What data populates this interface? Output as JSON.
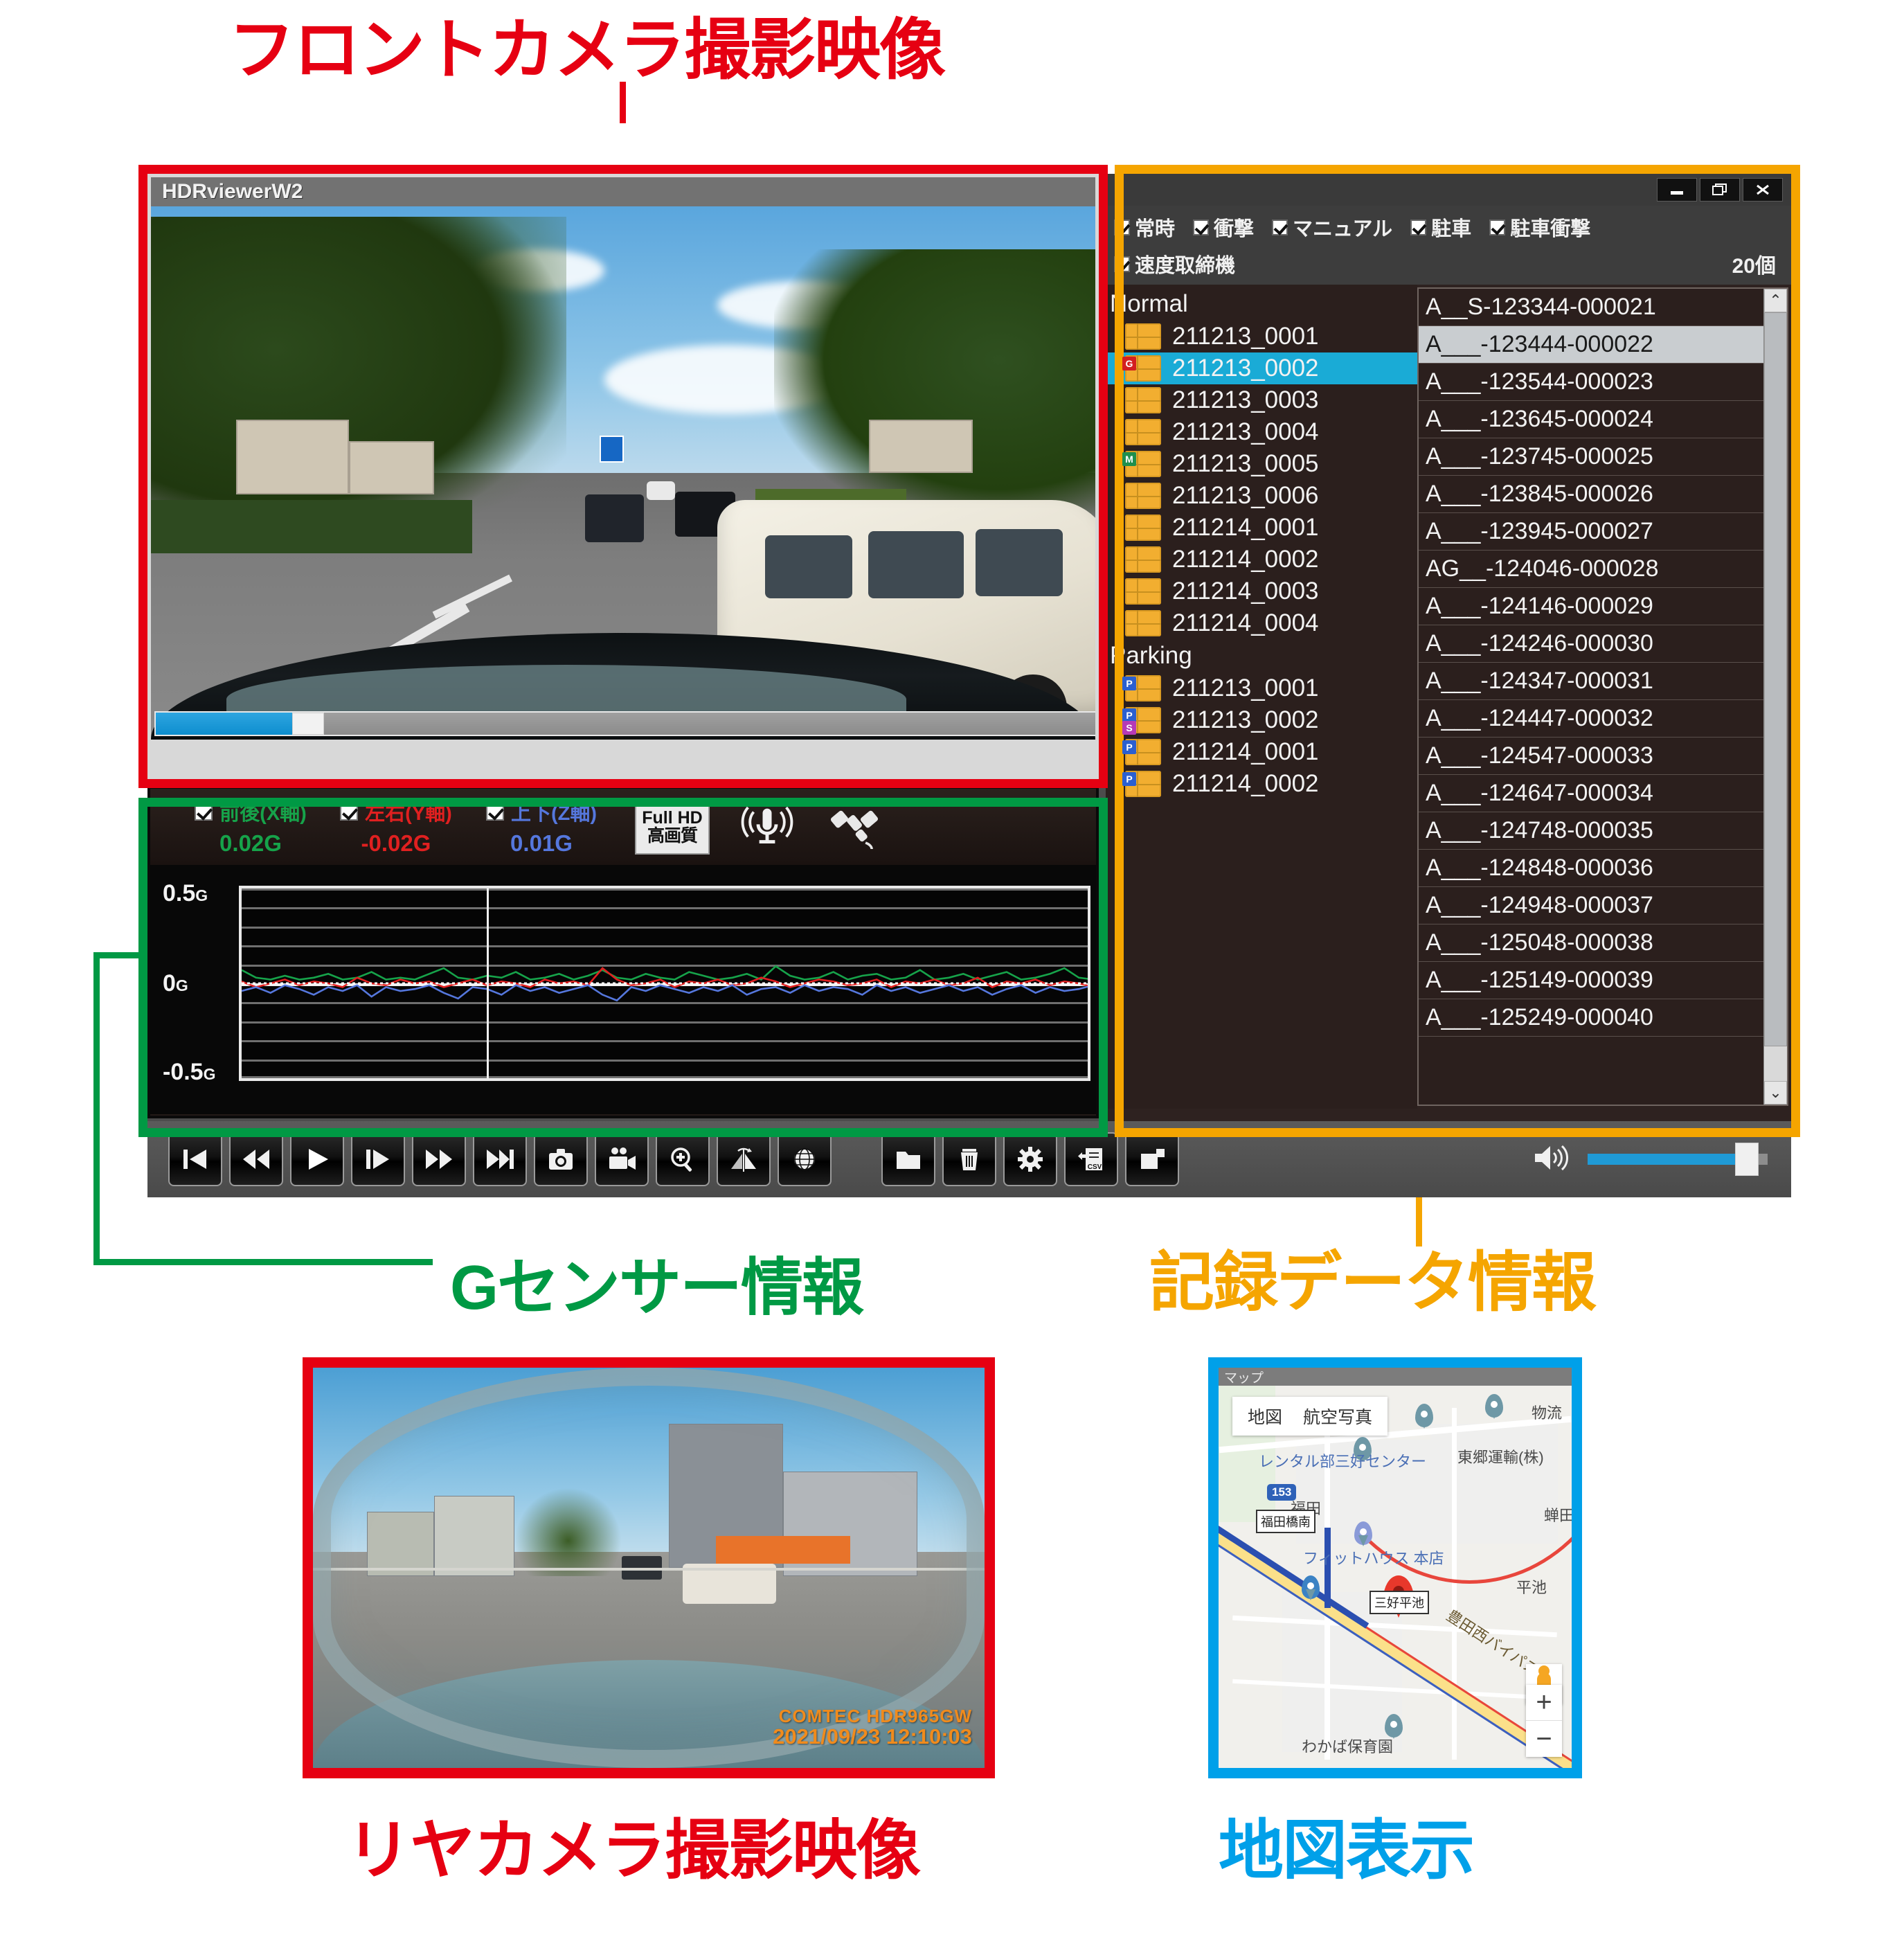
{
  "annotations": {
    "front_camera": "フロントカメラ撮影映像",
    "g_sensor": "Gセンサー情報",
    "record_data": "記録データ情報",
    "rear_camera": "リヤカメラ撮影映像",
    "map_display": "地図表示"
  },
  "colors": {
    "red": "#e60012",
    "green": "#009944",
    "orange": "#f5a500",
    "blue": "#00a0e9",
    "selection_cyan": "#1aabd6"
  },
  "front_panel": {
    "title": "HDRviewerW2",
    "seek_percent": 14.5
  },
  "g_sensor": {
    "axes": [
      {
        "label": "前後(X軸)",
        "value": "0.02G",
        "checked": true,
        "color": "#16a34a"
      },
      {
        "label": "左右(Y軸)",
        "value": "-0.02G",
        "checked": true,
        "color": "#e02020"
      },
      {
        "label": "上下(Z軸)",
        "value": "0.01G",
        "checked": true,
        "color": "#5577dd"
      }
    ],
    "quality_badge": {
      "line1": "Full HD",
      "line2": "高画質"
    },
    "mic_icon": "microphone-icon",
    "gps_icon": "satellite-icon",
    "y_labels": {
      "top": "0.5",
      "mid": "0",
      "bottom": "-0.5"
    },
    "y_unit": "G"
  },
  "chart_data": {
    "type": "line",
    "title": "Gセンサー情報",
    "xlabel": "",
    "ylabel": "G",
    "ylim": [
      -0.5,
      0.5
    ],
    "grid": true,
    "cursor_position_pct": 29,
    "series": [
      {
        "name": "前後(X軸)",
        "color": "#16a34a",
        "current": 0.02,
        "values": [
          0.07,
          0.03,
          0.02,
          0.04,
          0.02,
          0.03,
          0.05,
          0.02,
          0.03,
          0.06,
          0.02,
          0.03,
          0.02,
          0.05,
          0.08,
          0.03,
          0.02,
          0.04,
          0.03,
          0.06,
          0.02,
          0.03,
          0.05,
          0.02,
          0.04,
          0.07,
          0.03,
          0.02,
          0.05,
          0.03,
          0.02,
          0.06,
          0.04,
          0.02,
          0.03,
          0.05,
          0.02,
          0.09,
          0.04,
          0.02,
          0.03,
          0.06,
          0.02,
          0.04,
          0.05,
          0.02,
          0.03,
          0.07,
          0.02,
          0.03,
          0.05,
          0.02,
          0.04,
          0.06,
          0.02,
          0.03,
          0.05,
          0.08,
          0.03,
          0.02
        ]
      },
      {
        "name": "左右(Y軸)",
        "color": "#e02020",
        "current": -0.02,
        "values": [
          0.01,
          -0.02,
          0.0,
          0.02,
          -0.01,
          0.01,
          0.0,
          -0.02,
          0.03,
          0.0,
          -0.01,
          0.02,
          0.0,
          0.01,
          -0.02,
          0.0,
          0.02,
          -0.01,
          0.01,
          0.0,
          -0.02,
          0.02,
          0.0,
          0.01,
          -0.01,
          0.08,
          0.02,
          -0.01,
          0.0,
          0.02,
          -0.02,
          0.01,
          0.0,
          0.02,
          -0.01,
          0.0,
          0.03,
          0.01,
          -0.02,
          0.0,
          0.02,
          0.01,
          -0.01,
          0.0,
          0.02,
          -0.02,
          0.01,
          0.0,
          0.02,
          -0.01,
          0.0,
          0.03,
          -0.02,
          0.01,
          0.0,
          0.02,
          -0.01,
          0.01,
          0.0,
          -0.02
        ]
      },
      {
        "name": "上下(Z軸)",
        "color": "#5577dd",
        "current": 0.01,
        "values": [
          -0.04,
          -0.02,
          -0.05,
          -0.01,
          -0.03,
          -0.06,
          -0.02,
          -0.04,
          -0.01,
          -0.07,
          -0.02,
          -0.04,
          -0.03,
          -0.01,
          -0.05,
          -0.08,
          -0.02,
          -0.03,
          -0.06,
          -0.01,
          -0.04,
          -0.02,
          -0.05,
          -0.03,
          -0.01,
          -0.06,
          -0.09,
          -0.02,
          -0.04,
          -0.01,
          -0.03,
          -0.05,
          -0.02,
          -0.04,
          -0.01,
          -0.06,
          -0.03,
          -0.02,
          -0.05,
          -0.01,
          -0.04,
          -0.02,
          -0.03,
          -0.06,
          -0.01,
          -0.04,
          -0.02,
          -0.05,
          -0.03,
          -0.01,
          -0.04,
          -0.02,
          -0.06,
          -0.03,
          -0.01,
          -0.05,
          -0.02,
          -0.04,
          -0.03,
          -0.01
        ]
      }
    ]
  },
  "toolbar": {
    "buttons": [
      {
        "name": "skip-to-start-button",
        "icon": "skip-start-icon"
      },
      {
        "name": "rewind-button",
        "icon": "rewind-icon"
      },
      {
        "name": "play-button",
        "icon": "play-icon"
      },
      {
        "name": "frame-advance-button",
        "icon": "frame-step-icon"
      },
      {
        "name": "fast-forward-button",
        "icon": "fast-forward-icon"
      },
      {
        "name": "skip-to-end-button",
        "icon": "skip-end-icon"
      },
      {
        "name": "snapshot-button",
        "icon": "camera-icon"
      },
      {
        "name": "video-clip-button",
        "icon": "video-camera-icon"
      },
      {
        "name": "zoom-button",
        "icon": "magnifier-plus-icon"
      },
      {
        "name": "flip-image-button",
        "icon": "mirror-flip-icon"
      },
      {
        "name": "map-globe-button",
        "icon": "globe-icon"
      },
      {
        "name": "open-folder-button",
        "icon": "folder-icon"
      },
      {
        "name": "delete-button",
        "icon": "trash-icon"
      },
      {
        "name": "settings-button",
        "icon": "gear-icon"
      },
      {
        "name": "csv-export-button",
        "icon": "csv-export-icon"
      },
      {
        "name": "copy-file-button",
        "icon": "copy-file-icon"
      }
    ],
    "volume": {
      "icon": "speaker-icon",
      "level_percent": 84
    }
  },
  "record_panel": {
    "window_buttons": [
      {
        "name": "minimize-button",
        "glyph": "▬"
      },
      {
        "name": "restore-button",
        "glyph": "❐"
      },
      {
        "name": "close-button",
        "glyph": "✕"
      }
    ],
    "filters_row1": [
      {
        "label": "常時",
        "checked": true
      },
      {
        "label": "衝撃",
        "checked": true
      },
      {
        "label": "マニュアル",
        "checked": true
      },
      {
        "label": "駐車",
        "checked": true
      },
      {
        "label": "駐車衝撃",
        "checked": true
      }
    ],
    "filters_row2": [
      {
        "label": "速度取締機",
        "checked": true
      }
    ],
    "count_label": "20個",
    "tree": [
      {
        "type": "group",
        "label": "Normal"
      },
      {
        "type": "item",
        "label": "211213_0001",
        "badges": [],
        "selected": false
      },
      {
        "type": "item",
        "label": "211213_0002",
        "badges": [
          "G"
        ],
        "selected": true
      },
      {
        "type": "item",
        "label": "211213_0003",
        "badges": [],
        "selected": false
      },
      {
        "type": "item",
        "label": "211213_0004",
        "badges": [],
        "selected": false
      },
      {
        "type": "item",
        "label": "211213_0005",
        "badges": [
          "M"
        ],
        "selected": false
      },
      {
        "type": "item",
        "label": "211213_0006",
        "badges": [],
        "selected": false
      },
      {
        "type": "item",
        "label": "211214_0001",
        "badges": [],
        "selected": false
      },
      {
        "type": "item",
        "label": "211214_0002",
        "badges": [],
        "selected": false
      },
      {
        "type": "item",
        "label": "211214_0003",
        "badges": [],
        "selected": false
      },
      {
        "type": "item",
        "label": "211214_0004",
        "badges": [],
        "selected": false
      },
      {
        "type": "group",
        "label": "Parking"
      },
      {
        "type": "item",
        "label": "211213_0001",
        "badges": [
          "P"
        ],
        "selected": false
      },
      {
        "type": "item",
        "label": "211213_0002",
        "badges": [
          "P",
          "S"
        ],
        "selected": false
      },
      {
        "type": "item",
        "label": "211214_0001",
        "badges": [
          "P"
        ],
        "selected": false
      },
      {
        "type": "item",
        "label": "211214_0002",
        "badges": [
          "P"
        ],
        "selected": false
      }
    ],
    "files": [
      {
        "label": "A__S-123344-000021",
        "selected": false
      },
      {
        "label": "A___-123444-000022",
        "selected": true
      },
      {
        "label": "A___-123544-000023",
        "selected": false
      },
      {
        "label": "A___-123645-000024",
        "selected": false
      },
      {
        "label": "A___-123745-000025",
        "selected": false
      },
      {
        "label": "A___-123845-000026",
        "selected": false
      },
      {
        "label": "A___-123945-000027",
        "selected": false
      },
      {
        "label": "AG__-124046-000028",
        "selected": false
      },
      {
        "label": "A___-124146-000029",
        "selected": false
      },
      {
        "label": "A___-124246-000030",
        "selected": false
      },
      {
        "label": "A___-124347-000031",
        "selected": false
      },
      {
        "label": "A___-124447-000032",
        "selected": false
      },
      {
        "label": "A___-124547-000033",
        "selected": false
      },
      {
        "label": "A___-124647-000034",
        "selected": false
      },
      {
        "label": "A___-124748-000035",
        "selected": false
      },
      {
        "label": "A___-124848-000036",
        "selected": false
      },
      {
        "label": "A___-124948-000037",
        "selected": false
      },
      {
        "label": "A___-125048-000038",
        "selected": false
      },
      {
        "label": "A___-125149-000039",
        "selected": false
      },
      {
        "label": "A___-125249-000040",
        "selected": false
      }
    ],
    "scroll_up_glyph": "⌃",
    "scroll_down_glyph": "⌄"
  },
  "rear_panel": {
    "watermark_brand": "COMTEC  HDR965GW",
    "watermark_timestamp": "2021/09/23 12:10:03"
  },
  "map_panel": {
    "titlebar": "マップ",
    "type_buttons": [
      {
        "label": "地図"
      },
      {
        "label": "航空写真"
      }
    ],
    "labels": [
      "レンタル部三好センター",
      "東郷運輸(株)",
      "物流",
      "福田",
      "蝉田",
      "フィットハウス 本店",
      "平池",
      "豊田西バイパス",
      "わかば保育園"
    ],
    "signs": [
      "福田橋南",
      "三好平池"
    ],
    "route_shield": "153",
    "zoom_in": "+",
    "zoom_out": "−",
    "pegman": "street-view-pegman"
  }
}
